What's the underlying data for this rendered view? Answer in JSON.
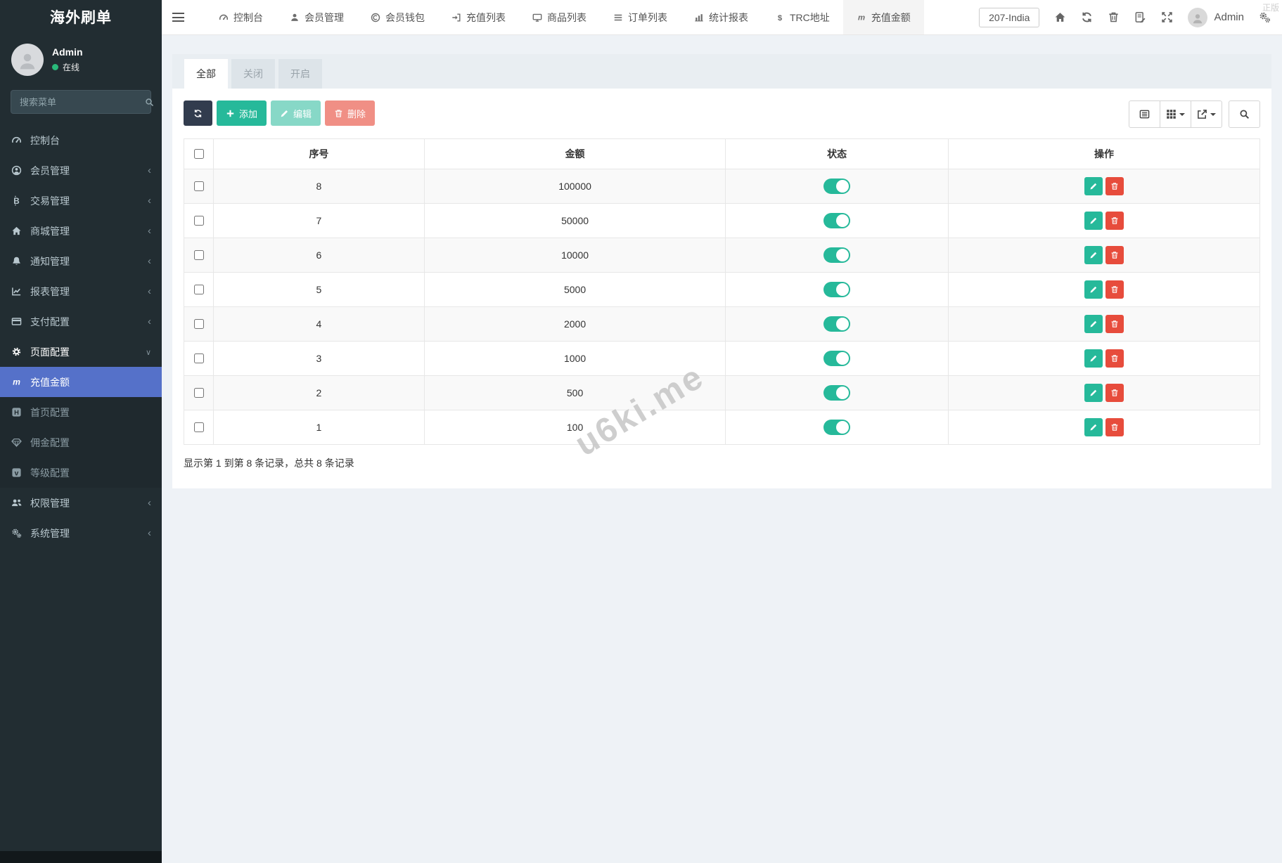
{
  "app": {
    "title": "海外刷单",
    "watermark": "u6ki.me",
    "genuine": "正版"
  },
  "colors": {
    "accent": "#5571c9",
    "success": "#26b99a",
    "danger": "#e74c3c",
    "sidebar_bg": "#222d32",
    "dark_button": "#323c4e"
  },
  "sidebar": {
    "user": {
      "name": "Admin",
      "status": "在线"
    },
    "search": {
      "placeholder": "搜索菜单",
      "icon": "search-icon"
    },
    "items": [
      {
        "label": "控制台",
        "icon": "gauge-icon"
      },
      {
        "label": "会员管理",
        "icon": "user-circle-icon"
      },
      {
        "label": "交易管理",
        "icon": "bitcoin-icon"
      },
      {
        "label": "商城管理",
        "icon": "home-icon"
      },
      {
        "label": "通知管理",
        "icon": "bell-icon"
      },
      {
        "label": "报表管理",
        "icon": "line-chart-icon"
      },
      {
        "label": "支付配置",
        "icon": "credit-card-icon"
      },
      {
        "label": "页面配置",
        "icon": "gear-icon"
      },
      {
        "label": "权限管理",
        "icon": "users-icon"
      },
      {
        "label": "系统管理",
        "icon": "cogs-icon"
      }
    ],
    "submenu": [
      {
        "label": "充值金额",
        "icon": "m-icon",
        "active": true
      },
      {
        "label": "首页配置",
        "icon": "h-square-icon"
      },
      {
        "label": "佣金配置",
        "icon": "gem-icon"
      },
      {
        "label": "等级配置",
        "icon": "v-square-icon"
      }
    ]
  },
  "navbar": {
    "tabs": [
      {
        "label": "控制台",
        "icon": "gauge-icon"
      },
      {
        "label": "会员管理",
        "icon": "user-icon"
      },
      {
        "label": "会员钱包",
        "icon": "coin-icon"
      },
      {
        "label": "充值列表",
        "icon": "sign-in-icon"
      },
      {
        "label": "商品列表",
        "icon": "desktop-icon"
      },
      {
        "label": "订单列表",
        "icon": "list-icon"
      },
      {
        "label": "统计报表",
        "icon": "bar-chart-icon"
      },
      {
        "label": "TRC地址",
        "icon": "dollar-icon"
      },
      {
        "label": "充值金额",
        "icon": "m-icon",
        "active": true
      }
    ],
    "region": "207-India",
    "right_icons": [
      "home-icon",
      "refresh-icon",
      "trash-icon",
      "log-icon",
      "expand-icon"
    ],
    "user": "Admin",
    "user_menu_icon": "cogs-icon"
  },
  "filter_tabs": {
    "all": "全部",
    "closed": "关闭",
    "open": "开启"
  },
  "toolbar": {
    "refresh_icon": "refresh-icon",
    "add": "添加",
    "edit": "编辑",
    "delete": "删除",
    "view_icons": [
      "list-alt-icon",
      "columns-grid-icon",
      "export-icon",
      "search-icon"
    ]
  },
  "table": {
    "headers": {
      "id": "序号",
      "amount": "金额",
      "status": "状态",
      "actions": "操作"
    },
    "rows": [
      {
        "id": "8",
        "amount": "100000",
        "status_on": true
      },
      {
        "id": "7",
        "amount": "50000",
        "status_on": true
      },
      {
        "id": "6",
        "amount": "10000",
        "status_on": true
      },
      {
        "id": "5",
        "amount": "5000",
        "status_on": true
      },
      {
        "id": "4",
        "amount": "2000",
        "status_on": true
      },
      {
        "id": "3",
        "amount": "1000",
        "status_on": true
      },
      {
        "id": "2",
        "amount": "500",
        "status_on": true
      },
      {
        "id": "1",
        "amount": "100",
        "status_on": true
      }
    ]
  },
  "footer": {
    "summary": "显示第 1 到第 8 条记录，总共 8 条记录"
  }
}
